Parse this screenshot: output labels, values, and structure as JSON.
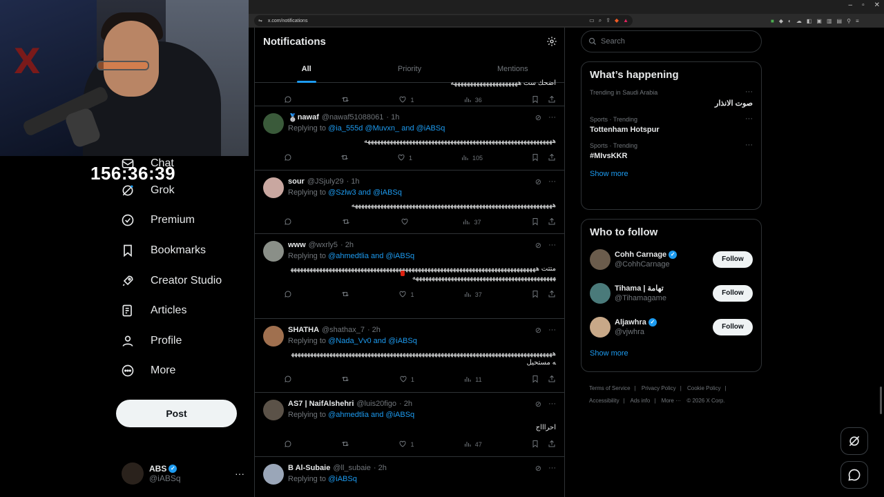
{
  "browser": {
    "url": "x.com/notifications",
    "window_buttons": [
      "–",
      "▫",
      "✕"
    ]
  },
  "stream": {
    "timer": "156:36:39"
  },
  "nav": {
    "items": [
      {
        "label": "Chat",
        "icon": "chat-icon"
      },
      {
        "label": "Grok",
        "icon": "grok-icon"
      },
      {
        "label": "Premium",
        "icon": "premium-icon"
      },
      {
        "label": "Bookmarks",
        "icon": "bookmark-icon"
      },
      {
        "label": "Creator Studio",
        "icon": "rocket-icon"
      },
      {
        "label": "Articles",
        "icon": "articles-icon"
      },
      {
        "label": "Profile",
        "icon": "profile-icon"
      },
      {
        "label": "More",
        "icon": "more-circle-icon"
      }
    ],
    "post_label": "Post"
  },
  "account": {
    "name": "ABS",
    "handle": "@iABSq",
    "more": "···"
  },
  "main": {
    "title": "Notifications",
    "tabs": [
      {
        "label": "All",
        "active": true
      },
      {
        "label": "Priority",
        "active": false
      },
      {
        "label": "Mentions",
        "active": false
      }
    ]
  },
  "tweets": [
    {
      "partial": true,
      "body": "اضحك ست هههههههههههههههههههههه",
      "likes": "1",
      "views": "36"
    },
    {
      "badge": "🥈",
      "name": "nawaf",
      "handle": "@nawaf51088061",
      "time": "· 1h",
      "reply_prefix": "Replying to ",
      "mentions": "@ia_555d @Muvxn_ and @iABSq",
      "body": "هههههههههههههههههههههههههههههههههههههههههههههههههههههههههههه",
      "likes": "1",
      "views": "105",
      "avatar_color": "#3a5a3a"
    },
    {
      "name": "sour",
      "handle": "@JSjuly29",
      "time": "· 1h",
      "reply_prefix": "Replying to ",
      "mentions": "@Szlw3 and @iABSq",
      "body": "هههههههههههههههههههههههههههههههههههههههههههههههههههههههههههههههه",
      "likes": "",
      "views": "37",
      "avatar_color": "#c9a7a0"
    },
    {
      "name": "www",
      "handle": "@wxrly5",
      "time": "· 2h",
      "reply_prefix": "Replying to ",
      "mentions": "@ahmedtlia and @iABSq",
      "body": "متتت ههههههههههههههههههههههههههههههههههههههههههههههههههههههههههههههههههههههههههههههههههههههههههههههههههههههههههههههههههههههههههه",
      "likes": "1",
      "views": "37",
      "avatar_color": "#8a8f88"
    },
    {
      "name": "SHATHA",
      "handle": "@shathax_7",
      "time": "· 2h",
      "reply_prefix": "Replying to ",
      "mentions": "@Nada_Vv0 and @iABSq",
      "body": "هههههههههههههههههههههههههههههههههههههههههههههههههههههههههههههههههههههههههههههههههههه مستحيل",
      "likes": "1",
      "views": "11",
      "avatar_color": "#a0704f"
    },
    {
      "name": "AS7 | NaifAlshehri",
      "handle": "@luis20figo",
      "time": "· 2h",
      "reply_prefix": "Replying to ",
      "mentions": "@ahmedtlia and @iABSq",
      "body": "احراااج",
      "likes": "1",
      "views": "47",
      "avatar_color": "#5b5248"
    },
    {
      "name": "B Al-Subaie",
      "handle": "@ll_subaie",
      "time": "· 2h",
      "reply_prefix": "Replying to ",
      "mentions": "@iABSq",
      "body": "",
      "likes": "",
      "views": "",
      "avatar_color": "#9aa6b8"
    }
  ],
  "sidebar": {
    "search_placeholder": "Search",
    "happening": {
      "title": "What’s happening",
      "trends": [
        {
          "meta": "Trending in Saudi Arabia",
          "name": "صوت الانذار",
          "rtl": true
        },
        {
          "meta": "Sports · Trending",
          "name": "Tottenham Hotspur",
          "rtl": false
        },
        {
          "meta": "Sports · Trending",
          "name": "#MIvsKKR",
          "rtl": false
        }
      ],
      "show_more": "Show more"
    },
    "who_to_follow": {
      "title": "Who to follow",
      "users": [
        {
          "name": "Cohh Carnage",
          "handle": "@CohhCarnage",
          "verified": true,
          "avatar_color": "#6b5c4c"
        },
        {
          "name": "Tihama | تهامة",
          "handle": "@Tihamagame",
          "verified": false,
          "avatar_color": "#4a7a7a"
        },
        {
          "name": "Aljawhra",
          "handle": "@vjwhra",
          "verified": true,
          "avatar_color": "#c8a888"
        }
      ],
      "follow_label": "Follow",
      "show_more": "Show more"
    },
    "footer": {
      "links": [
        "Terms of Service",
        "|",
        "Privacy Policy",
        "|",
        "Cookie Policy",
        "|",
        "Accessibility",
        "|",
        "Ads info",
        "|",
        "More ···",
        "© 2026 X Corp."
      ]
    }
  },
  "colors": {
    "accent": "#1d9bf0",
    "background": "#000000",
    "border": "#2f3336",
    "muted": "#71767b"
  }
}
